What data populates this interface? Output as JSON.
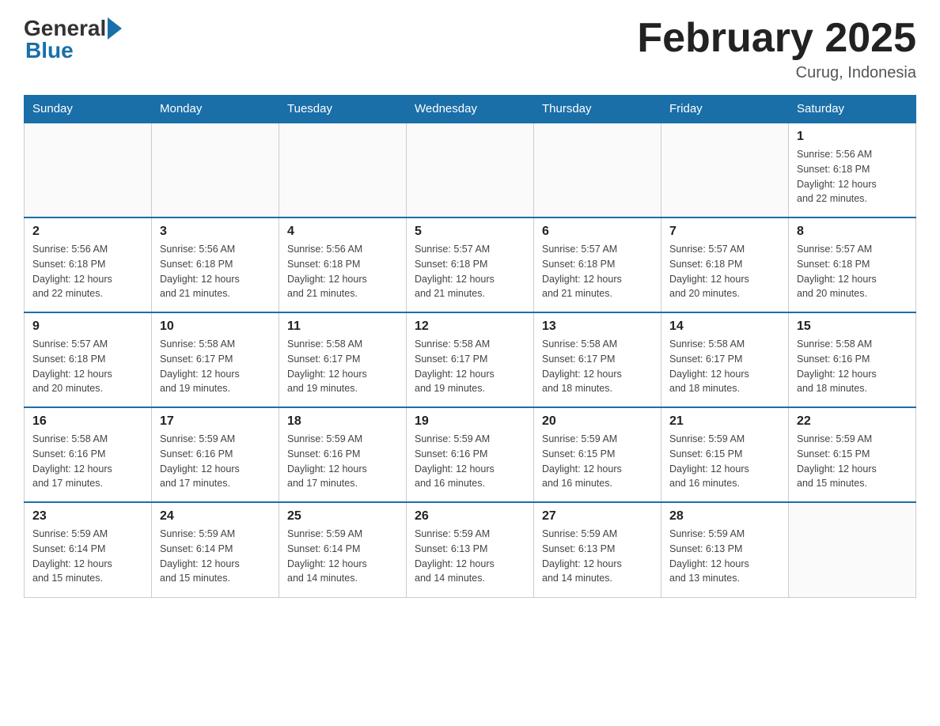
{
  "header": {
    "logo_general": "General",
    "logo_blue": "Blue",
    "month_title": "February 2025",
    "location": "Curug, Indonesia"
  },
  "weekdays": [
    "Sunday",
    "Monday",
    "Tuesday",
    "Wednesday",
    "Thursday",
    "Friday",
    "Saturday"
  ],
  "weeks": [
    [
      {
        "day": "",
        "info": ""
      },
      {
        "day": "",
        "info": ""
      },
      {
        "day": "",
        "info": ""
      },
      {
        "day": "",
        "info": ""
      },
      {
        "day": "",
        "info": ""
      },
      {
        "day": "",
        "info": ""
      },
      {
        "day": "1",
        "info": "Sunrise: 5:56 AM\nSunset: 6:18 PM\nDaylight: 12 hours\nand 22 minutes."
      }
    ],
    [
      {
        "day": "2",
        "info": "Sunrise: 5:56 AM\nSunset: 6:18 PM\nDaylight: 12 hours\nand 22 minutes."
      },
      {
        "day": "3",
        "info": "Sunrise: 5:56 AM\nSunset: 6:18 PM\nDaylight: 12 hours\nand 21 minutes."
      },
      {
        "day": "4",
        "info": "Sunrise: 5:56 AM\nSunset: 6:18 PM\nDaylight: 12 hours\nand 21 minutes."
      },
      {
        "day": "5",
        "info": "Sunrise: 5:57 AM\nSunset: 6:18 PM\nDaylight: 12 hours\nand 21 minutes."
      },
      {
        "day": "6",
        "info": "Sunrise: 5:57 AM\nSunset: 6:18 PM\nDaylight: 12 hours\nand 21 minutes."
      },
      {
        "day": "7",
        "info": "Sunrise: 5:57 AM\nSunset: 6:18 PM\nDaylight: 12 hours\nand 20 minutes."
      },
      {
        "day": "8",
        "info": "Sunrise: 5:57 AM\nSunset: 6:18 PM\nDaylight: 12 hours\nand 20 minutes."
      }
    ],
    [
      {
        "day": "9",
        "info": "Sunrise: 5:57 AM\nSunset: 6:18 PM\nDaylight: 12 hours\nand 20 minutes."
      },
      {
        "day": "10",
        "info": "Sunrise: 5:58 AM\nSunset: 6:17 PM\nDaylight: 12 hours\nand 19 minutes."
      },
      {
        "day": "11",
        "info": "Sunrise: 5:58 AM\nSunset: 6:17 PM\nDaylight: 12 hours\nand 19 minutes."
      },
      {
        "day": "12",
        "info": "Sunrise: 5:58 AM\nSunset: 6:17 PM\nDaylight: 12 hours\nand 19 minutes."
      },
      {
        "day": "13",
        "info": "Sunrise: 5:58 AM\nSunset: 6:17 PM\nDaylight: 12 hours\nand 18 minutes."
      },
      {
        "day": "14",
        "info": "Sunrise: 5:58 AM\nSunset: 6:17 PM\nDaylight: 12 hours\nand 18 minutes."
      },
      {
        "day": "15",
        "info": "Sunrise: 5:58 AM\nSunset: 6:16 PM\nDaylight: 12 hours\nand 18 minutes."
      }
    ],
    [
      {
        "day": "16",
        "info": "Sunrise: 5:58 AM\nSunset: 6:16 PM\nDaylight: 12 hours\nand 17 minutes."
      },
      {
        "day": "17",
        "info": "Sunrise: 5:59 AM\nSunset: 6:16 PM\nDaylight: 12 hours\nand 17 minutes."
      },
      {
        "day": "18",
        "info": "Sunrise: 5:59 AM\nSunset: 6:16 PM\nDaylight: 12 hours\nand 17 minutes."
      },
      {
        "day": "19",
        "info": "Sunrise: 5:59 AM\nSunset: 6:16 PM\nDaylight: 12 hours\nand 16 minutes."
      },
      {
        "day": "20",
        "info": "Sunrise: 5:59 AM\nSunset: 6:15 PM\nDaylight: 12 hours\nand 16 minutes."
      },
      {
        "day": "21",
        "info": "Sunrise: 5:59 AM\nSunset: 6:15 PM\nDaylight: 12 hours\nand 16 minutes."
      },
      {
        "day": "22",
        "info": "Sunrise: 5:59 AM\nSunset: 6:15 PM\nDaylight: 12 hours\nand 15 minutes."
      }
    ],
    [
      {
        "day": "23",
        "info": "Sunrise: 5:59 AM\nSunset: 6:14 PM\nDaylight: 12 hours\nand 15 minutes."
      },
      {
        "day": "24",
        "info": "Sunrise: 5:59 AM\nSunset: 6:14 PM\nDaylight: 12 hours\nand 15 minutes."
      },
      {
        "day": "25",
        "info": "Sunrise: 5:59 AM\nSunset: 6:14 PM\nDaylight: 12 hours\nand 14 minutes."
      },
      {
        "day": "26",
        "info": "Sunrise: 5:59 AM\nSunset: 6:13 PM\nDaylight: 12 hours\nand 14 minutes."
      },
      {
        "day": "27",
        "info": "Sunrise: 5:59 AM\nSunset: 6:13 PM\nDaylight: 12 hours\nand 14 minutes."
      },
      {
        "day": "28",
        "info": "Sunrise: 5:59 AM\nSunset: 6:13 PM\nDaylight: 12 hours\nand 13 minutes."
      },
      {
        "day": "",
        "info": ""
      }
    ]
  ]
}
